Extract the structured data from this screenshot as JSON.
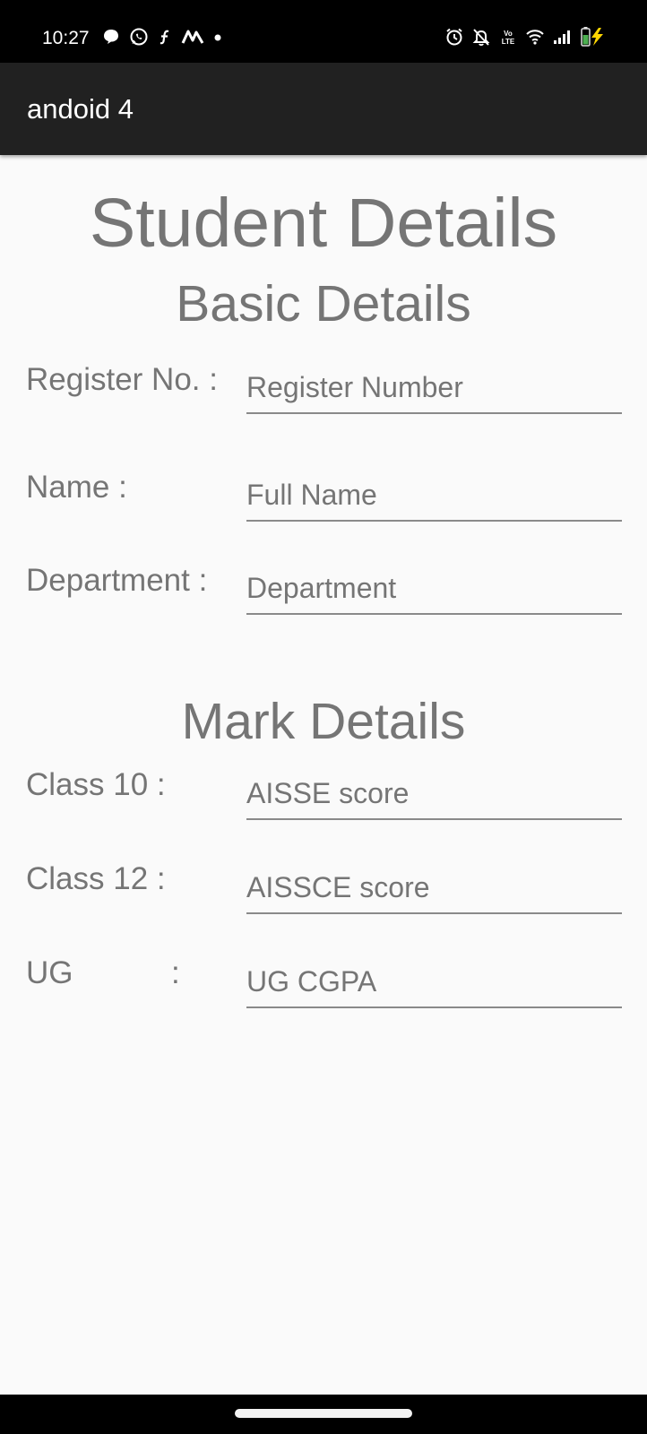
{
  "status_bar": {
    "time": "10:27",
    "left_icons": [
      "message-bubble-icon",
      "whatsapp-icon",
      "function-icon",
      "app-icon",
      "dot-icon"
    ],
    "right_icons": [
      "alarm-icon",
      "mute-icon",
      "volte-icon",
      "wifi-icon",
      "signal-icon",
      "battery-charging-icon"
    ],
    "volte_text": "VoLTE",
    "battery_color": "#4caf50",
    "charging_color": "#ffd600"
  },
  "app_bar": {
    "title": "andoid 4"
  },
  "page": {
    "title": "Student Details",
    "basic_section": {
      "heading": "Basic Details",
      "fields": [
        {
          "label": "Register No. :",
          "placeholder": "Register Number",
          "value": ""
        },
        {
          "label": "Name :",
          "placeholder": "Full Name",
          "value": ""
        },
        {
          "label": "Department :",
          "placeholder": "Department",
          "value": ""
        }
      ]
    },
    "marks_section": {
      "heading": "Mark Details",
      "fields": [
        {
          "label": "Class 10 :",
          "placeholder": "AISSE score",
          "value": ""
        },
        {
          "label": "Class 12 :",
          "placeholder": "AISSCE score",
          "value": ""
        },
        {
          "label": "UG",
          "colon": ":",
          "placeholder": "UG CGPA",
          "value": ""
        }
      ]
    }
  },
  "colors": {
    "app_bar": "#212121",
    "status_bar": "#000000",
    "background": "#fafafa",
    "text": "#757575"
  }
}
